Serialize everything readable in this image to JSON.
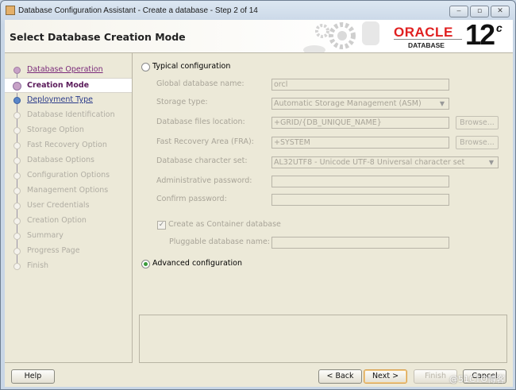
{
  "window": {
    "title": "Database Configuration Assistant - Create a database - Step 2 of 14",
    "controls": [
      "minimize",
      "maximize",
      "close"
    ]
  },
  "header": {
    "page_title": "Select Database Creation Mode",
    "brand": "ORACLE",
    "brand_sub": "DATABASE",
    "version": "12",
    "version_sup": "c",
    "brand_color": "#e02020"
  },
  "sidebar": {
    "steps": [
      {
        "label": "Database Operation",
        "state": "done"
      },
      {
        "label": "Creation Mode",
        "state": "current"
      },
      {
        "label": "Deployment Type",
        "state": "next"
      },
      {
        "label": "Database Identification",
        "state": "disabled"
      },
      {
        "label": "Storage Option",
        "state": "disabled"
      },
      {
        "label": "Fast Recovery Option",
        "state": "disabled"
      },
      {
        "label": "Database Options",
        "state": "disabled"
      },
      {
        "label": "Configuration Options",
        "state": "disabled"
      },
      {
        "label": "Management Options",
        "state": "disabled"
      },
      {
        "label": "User Credentials",
        "state": "disabled"
      },
      {
        "label": "Creation Option",
        "state": "disabled"
      },
      {
        "label": "Summary",
        "state": "disabled"
      },
      {
        "label": "Progress Page",
        "state": "disabled"
      },
      {
        "label": "Finish",
        "state": "disabled"
      }
    ]
  },
  "form": {
    "typical_label": "Typical configuration",
    "typical_selected": false,
    "global_db_name_label": "Global database name:",
    "global_db_name_value": "orcl",
    "storage_type_label": "Storage type:",
    "storage_type_value": "Automatic Storage Management (ASM)",
    "db_files_location_label": "Database files location:",
    "db_files_location_value": "+GRID/{DB_UNIQUE_NAME}",
    "fra_label": "Fast Recovery Area (FRA):",
    "fra_value": "+SYSTEM",
    "browse_label": "Browse...",
    "charset_label": "Database character set:",
    "charset_value": "AL32UTF8 - Unicode UTF-8 Universal character set",
    "admin_password_label": "Administrative password:",
    "admin_password_value": "",
    "confirm_password_label": "Confirm password:",
    "confirm_password_value": "",
    "container_label": "Create as Container database",
    "container_checked": true,
    "pdb_name_label": "Pluggable database name:",
    "pdb_name_value": "",
    "advanced_label": "Advanced configuration",
    "advanced_selected": true
  },
  "buttons": {
    "help": "Help",
    "back": "< Back",
    "next": "Next >",
    "finish": "Finish",
    "cancel": "Cancel"
  },
  "watermark": "@51CTO博客"
}
